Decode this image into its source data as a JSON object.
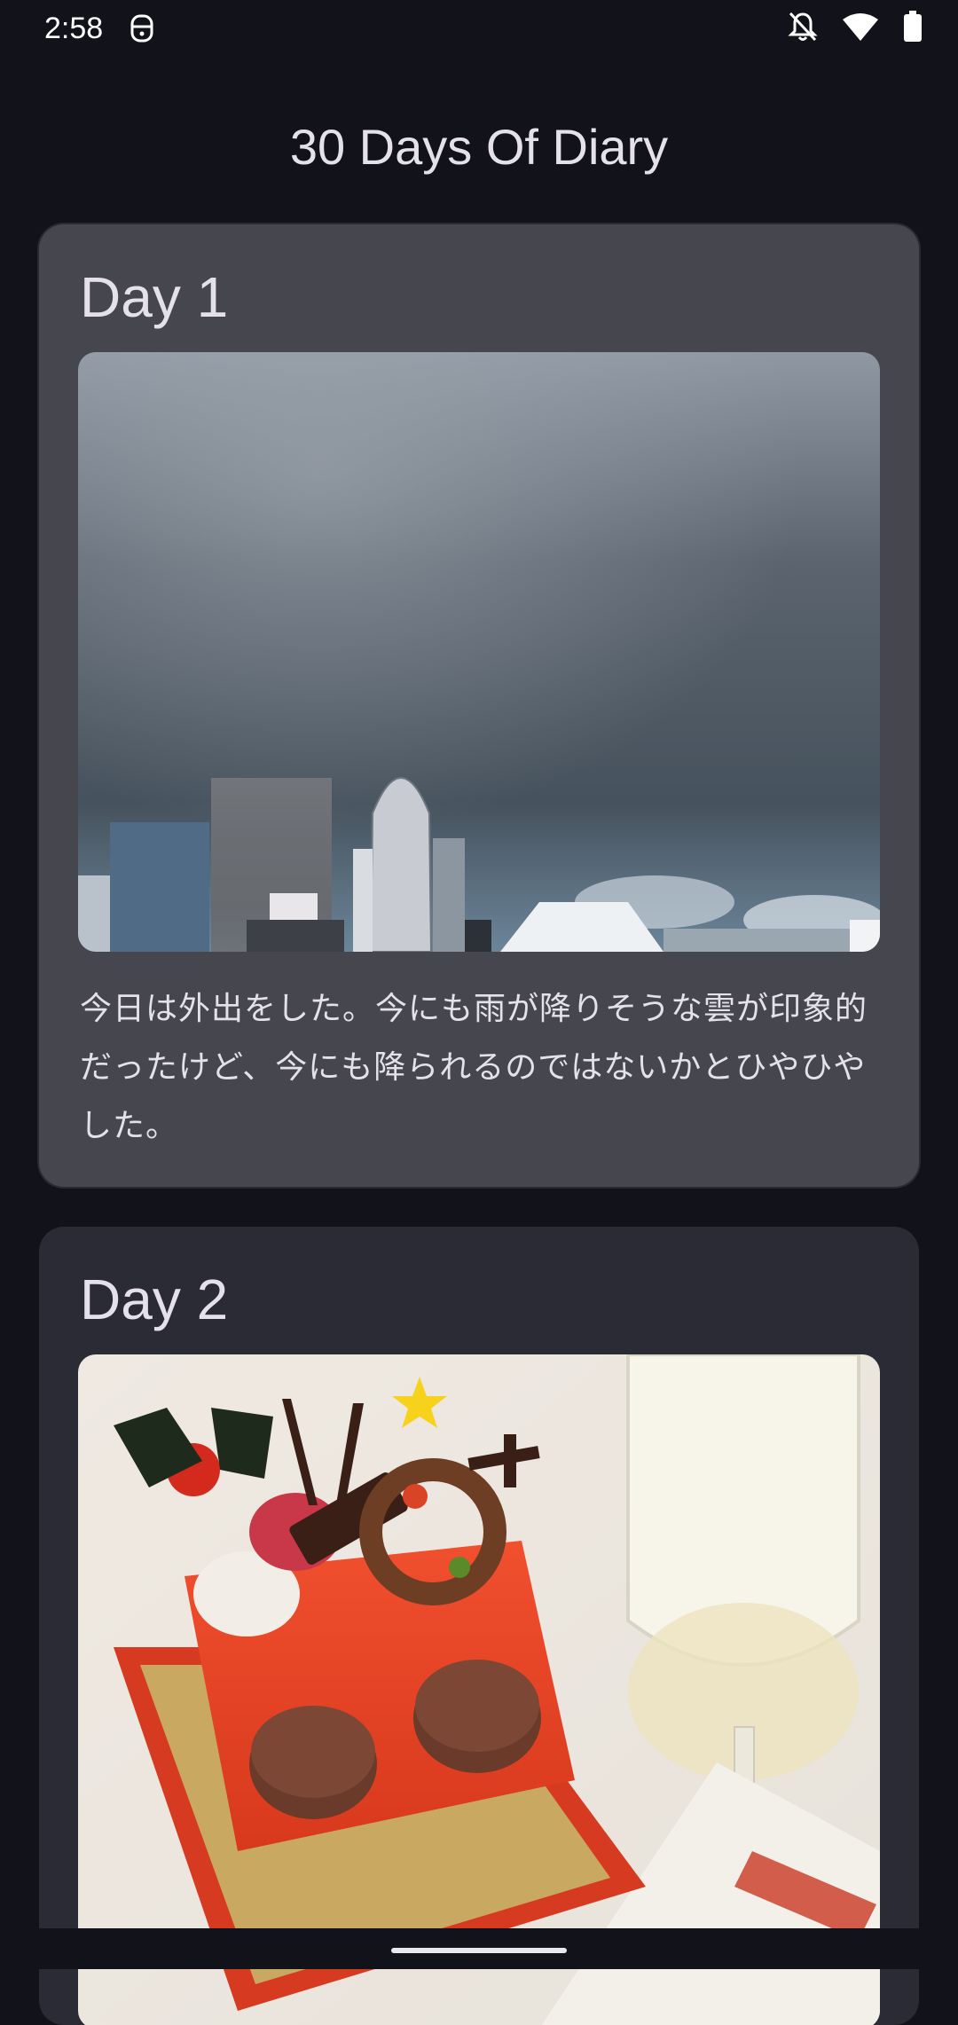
{
  "status_bar": {
    "time": "2:58",
    "left_icon": "face-icon",
    "icons": [
      "notifications-off-icon",
      "wifi-icon",
      "battery-icon"
    ]
  },
  "app": {
    "title": "30 Days Of Diary"
  },
  "entries": [
    {
      "day": "Day 1",
      "image": "city-skyline-cloudy-sky",
      "text": "今日は外出をした。今にも雨が降りそうな雲が印象的だったけど、今にも降られるのではないかとひやひやした。"
    },
    {
      "day": "Day 2",
      "image": "christmas-cake-with-wine-glass",
      "text": ""
    }
  ],
  "colors": {
    "background": "#12121a",
    "card_selected": "#46464f",
    "card": "#2b2b35",
    "text": "#e4e1ec"
  }
}
